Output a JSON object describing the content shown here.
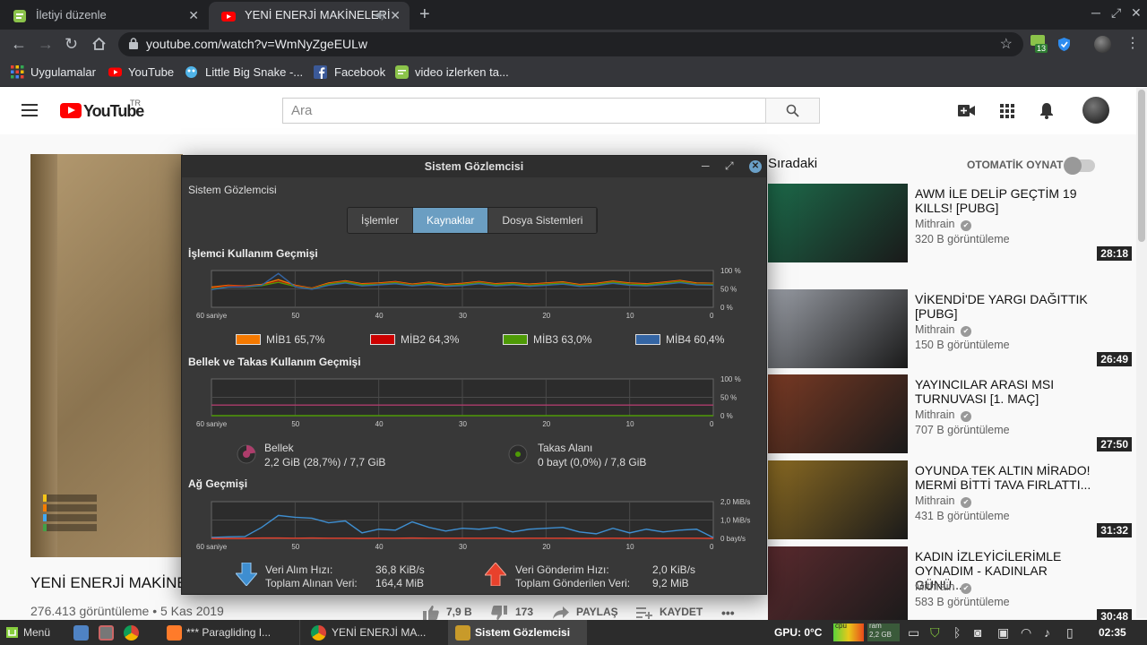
{
  "browser": {
    "tabs": [
      {
        "title": "İletiyi düzenle",
        "active": false
      },
      {
        "title": "YENİ ENERJİ MAKİNELERİ",
        "active": true
      }
    ],
    "url": "youtube.com/watch?v=WmNyZgeEULw",
    "ext_badge": "13",
    "bookmarks": [
      "Uygulamalar",
      "YouTube",
      "Little Big Snake -...",
      "Facebook",
      "video izlerken ta..."
    ]
  },
  "youtube": {
    "logo_text": "YouTube",
    "region": "TR",
    "search_placeholder": "Ara",
    "video": {
      "title": "YENİ ENERJİ MAKİNEL",
      "meta": "276.413 görüntüleme • 5 Kas 2019",
      "likes": "7,9 B",
      "dislikes": "173",
      "share": "PAYLAŞ",
      "save": "KAYDET",
      "more": "•••"
    },
    "up_next_label": "Sıradaki",
    "autoplay_label": "OTOMATİK OYNAT",
    "recommendations": [
      {
        "title": "AWM İLE DELİP GEÇTİM 19 KILLS! [PUBG]",
        "channel": "Mithrain",
        "views": "320 B görüntüleme",
        "duration": "28:18",
        "color": "#1c6a4a"
      },
      {
        "title": "VİKENDİ'DE YARGI DAĞITTIK [PUBG]",
        "channel": "Mithrain",
        "views": "150 B görüntüleme",
        "duration": "26:49",
        "color": "#9a9ea6"
      },
      {
        "title": "YAYINCILAR ARASI MSI TURNUVASI [1. MAÇ]",
        "channel": "Mithrain",
        "views": "707 B görüntüleme",
        "duration": "27:50",
        "color": "#7a3a24"
      },
      {
        "title": "OYUNDA TEK ALTIN MİRADO! MERMİ BİTTİ TAVA FIRLATTI...",
        "channel": "Mithrain",
        "views": "431 B görüntüleme",
        "duration": "31:32",
        "color": "#8a6a22"
      },
      {
        "title": "KADIN İZLEYİCİLERİMLE OYNADIM - KADINLAR GÜNÜ...",
        "channel": "Mithrain",
        "views": "583 B görüntüleme",
        "duration": "30:48",
        "color": "#5a2a2e"
      }
    ]
  },
  "monitor": {
    "window_title": "Sistem Gözlemcisi",
    "subtitle": "Sistem Gözlemcisi",
    "tabs": [
      {
        "label": "İşlemler",
        "active": false
      },
      {
        "label": "Kaynaklar",
        "active": true
      },
      {
        "label": "Dosya Sistemleri",
        "active": false
      }
    ],
    "cpu_title": "İşlemci Kullanım Geçmişi",
    "mem_title": "Bellek ve Takas Kullanım Geçmişi",
    "net_title": "Ağ Geçmişi",
    "x_label": "60 saniye",
    "x_ticks": [
      "50",
      "40",
      "30",
      "20",
      "10",
      "0"
    ],
    "cpu_y_ticks": [
      "100 %",
      "50 %",
      "0 %"
    ],
    "net_y_ticks": [
      "2,0 MiB/s",
      "1,0 MiB/s",
      "0 bayt/s"
    ],
    "cpus": [
      {
        "label": "MİB1 65,7%",
        "color": "#f57900"
      },
      {
        "label": "MİB2 64,3%",
        "color": "#cc0000"
      },
      {
        "label": "MİB3 63,0%",
        "color": "#4e9a06"
      },
      {
        "label": "MİB4 60,4%",
        "color": "#3465a4"
      }
    ],
    "memory": {
      "label": "Bellek",
      "value": "2,2 GiB (28,7%) / 7,7 GiB",
      "color": "#ad3d6b"
    },
    "swap": {
      "label": "Takas Alanı",
      "value": "0 bayt (0,0%) / 7,8 GiB",
      "color": "#4e9a06"
    },
    "net_rx": {
      "label": "Veri Alım Hızı:",
      "rate": "36,8 KiB/s",
      "total_label": "Toplam Alınan Veri:",
      "total": "164,4 MiB",
      "color": "#3e8ed0"
    },
    "net_tx": {
      "label": "Veri Gönderim Hızı:",
      "rate": "2,0 KiB/s",
      "total_label": "Toplam Gönderilen Veri:",
      "total": "9,2 MiB",
      "color": "#e8412c"
    }
  },
  "chart_data": [
    {
      "type": "line",
      "title": "İşlemci Kullanım Geçmişi",
      "x": [
        60,
        58,
        56,
        54,
        52,
        50,
        48,
        46,
        44,
        42,
        40,
        38,
        36,
        34,
        32,
        30,
        28,
        26,
        24,
        22,
        20,
        18,
        16,
        14,
        12,
        10,
        8,
        6,
        4,
        2,
        0
      ],
      "ylim": [
        0,
        100
      ],
      "series": [
        {
          "name": "MİB1",
          "values": [
            55,
            60,
            58,
            62,
            75,
            60,
            52,
            66,
            72,
            64,
            66,
            70,
            63,
            68,
            62,
            65,
            70,
            64,
            67,
            63,
            66,
            69,
            62,
            65,
            71,
            66,
            64,
            68,
            73,
            66,
            65
          ]
        },
        {
          "name": "MİB2",
          "values": [
            52,
            58,
            57,
            60,
            70,
            58,
            51,
            64,
            70,
            62,
            64,
            68,
            61,
            66,
            60,
            63,
            68,
            62,
            65,
            61,
            64,
            67,
            60,
            63,
            69,
            64,
            62,
            66,
            71,
            64,
            64
          ]
        },
        {
          "name": "MİB3",
          "values": [
            50,
            56,
            55,
            59,
            68,
            57,
            50,
            63,
            69,
            61,
            63,
            67,
            60,
            65,
            59,
            62,
            67,
            61,
            64,
            60,
            63,
            66,
            59,
            62,
            68,
            63,
            61,
            65,
            70,
            63,
            63
          ]
        },
        {
          "name": "MİB4",
          "values": [
            48,
            55,
            56,
            60,
            92,
            56,
            49,
            60,
            66,
            58,
            61,
            64,
            58,
            62,
            57,
            59,
            64,
            58,
            61,
            57,
            60,
            63,
            57,
            59,
            65,
            60,
            58,
            62,
            67,
            61,
            60
          ]
        }
      ]
    },
    {
      "type": "line",
      "title": "Bellek ve Takas Kullanım Geçmişi",
      "x": [
        60,
        0
      ],
      "ylim": [
        0,
        100
      ],
      "series": [
        {
          "name": "Bellek",
          "values": [
            28.7,
            28.7
          ]
        },
        {
          "name": "Takas Alanı",
          "values": [
            0,
            0
          ]
        }
      ]
    },
    {
      "type": "line",
      "title": "Ağ Geçmişi",
      "x": [
        60,
        58,
        56,
        54,
        52,
        50,
        48,
        46,
        44,
        42,
        40,
        38,
        36,
        34,
        32,
        30,
        28,
        26,
        24,
        22,
        20,
        18,
        16,
        14,
        12,
        10,
        8,
        6,
        4,
        2,
        0
      ],
      "ylim": [
        0,
        2.0
      ],
      "ylabel": "MiB/s",
      "series": [
        {
          "name": "Veri Alım Hızı",
          "values": [
            0.05,
            0.08,
            0.1,
            0.6,
            1.25,
            1.15,
            1.1,
            0.85,
            0.95,
            0.3,
            0.5,
            0.45,
            0.9,
            0.6,
            0.4,
            0.55,
            0.5,
            0.6,
            0.35,
            0.5,
            0.55,
            0.6,
            0.35,
            0.25,
            0.55,
            0.3,
            0.5,
            0.35,
            0.45,
            0.5,
            0.04
          ]
        },
        {
          "name": "Veri Gönderim Hızı",
          "values": [
            0.0,
            0.0,
            0.0,
            0.02,
            0.02,
            0.01,
            0.02,
            0.01,
            0.01,
            0.0,
            0.01,
            0.01,
            0.02,
            0.01,
            0.01,
            0.01,
            0.01,
            0.01,
            0.0,
            0.01,
            0.01,
            0.01,
            0.0,
            0.0,
            0.01,
            0.0,
            0.01,
            0.0,
            0.01,
            0.01,
            0.0
          ]
        }
      ]
    }
  ],
  "taskbar": {
    "menu": "Menü",
    "items": [
      "*** Paragliding I...",
      "YENİ ENERJİ MA...",
      "Sistem Gözlemcisi"
    ],
    "gpu": "GPU: 0°C",
    "cpu_label": "cpu",
    "ram_label": "ram",
    "ram_value": "2,2 GB",
    "time": "02:35"
  }
}
